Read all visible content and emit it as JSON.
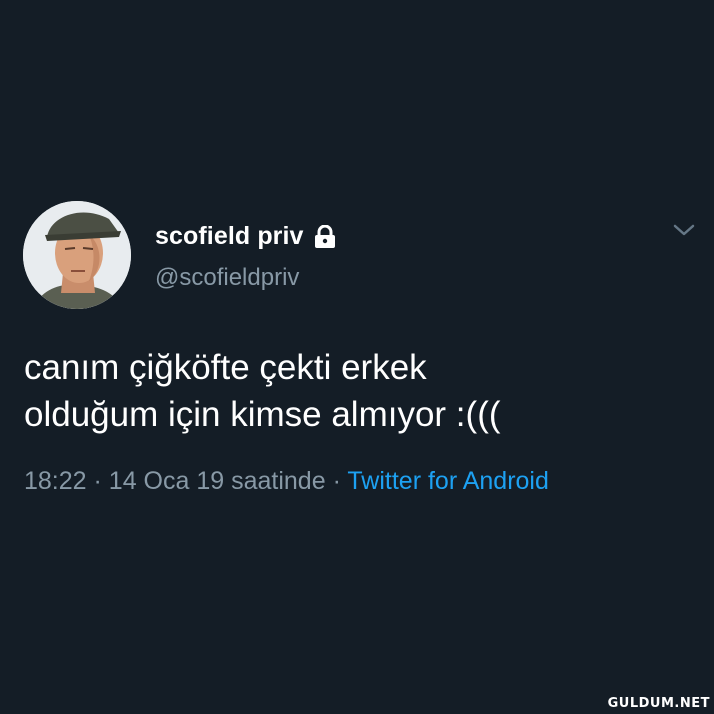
{
  "user": {
    "display_name": "scofield priv",
    "handle": "@scofieldpriv",
    "avatar_icon": "profile-photo",
    "protected_icon": "lock-icon"
  },
  "tweet": {
    "text_lines": [
      "canım çiğköfte çekti erkek",
      "olduğum için kimse almıyor :((("
    ],
    "time": "18:22",
    "separator": "·",
    "date": "14 Oca 19 saatinde",
    "source": "Twitter for Android"
  },
  "menu": {
    "icon": "chevron-down-icon"
  },
  "watermark": "GULDUM.NET",
  "colors": {
    "background": "#141d26",
    "primary_text": "#ffffff",
    "secondary_text": "#8899a6",
    "link": "#1da1f2"
  }
}
